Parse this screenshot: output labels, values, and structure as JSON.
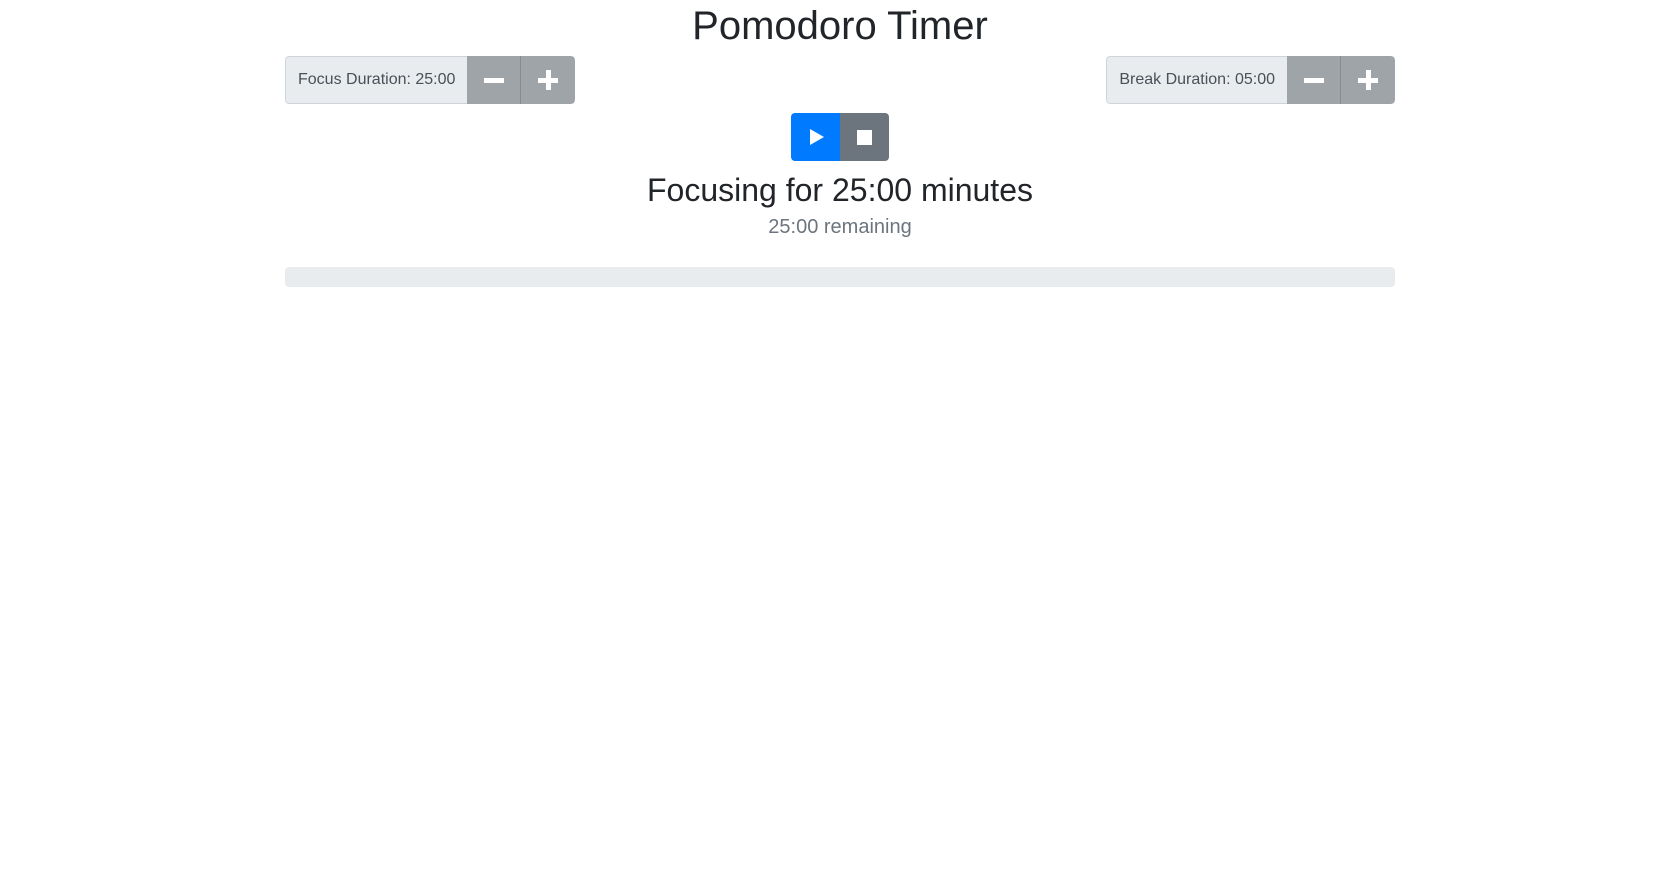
{
  "app": {
    "title": "Pomodoro Timer"
  },
  "focus": {
    "label": "Focus Duration: 25:00",
    "decrement_icon": "minus-icon",
    "increment_icon": "plus-icon"
  },
  "break": {
    "label": "Break Duration: 05:00",
    "decrement_icon": "minus-icon",
    "increment_icon": "plus-icon"
  },
  "controls": {
    "play_icon": "play-icon",
    "stop_icon": "stop-icon"
  },
  "status": {
    "heading": "Focusing for 25:00 minutes",
    "remaining": "25:00 remaining",
    "progress_fraction": 0
  },
  "colors": {
    "primary": "#007bff",
    "secondary": "#6c757d",
    "adjust_button": "#9fa4a9",
    "progress_track": "#e9ecef"
  }
}
